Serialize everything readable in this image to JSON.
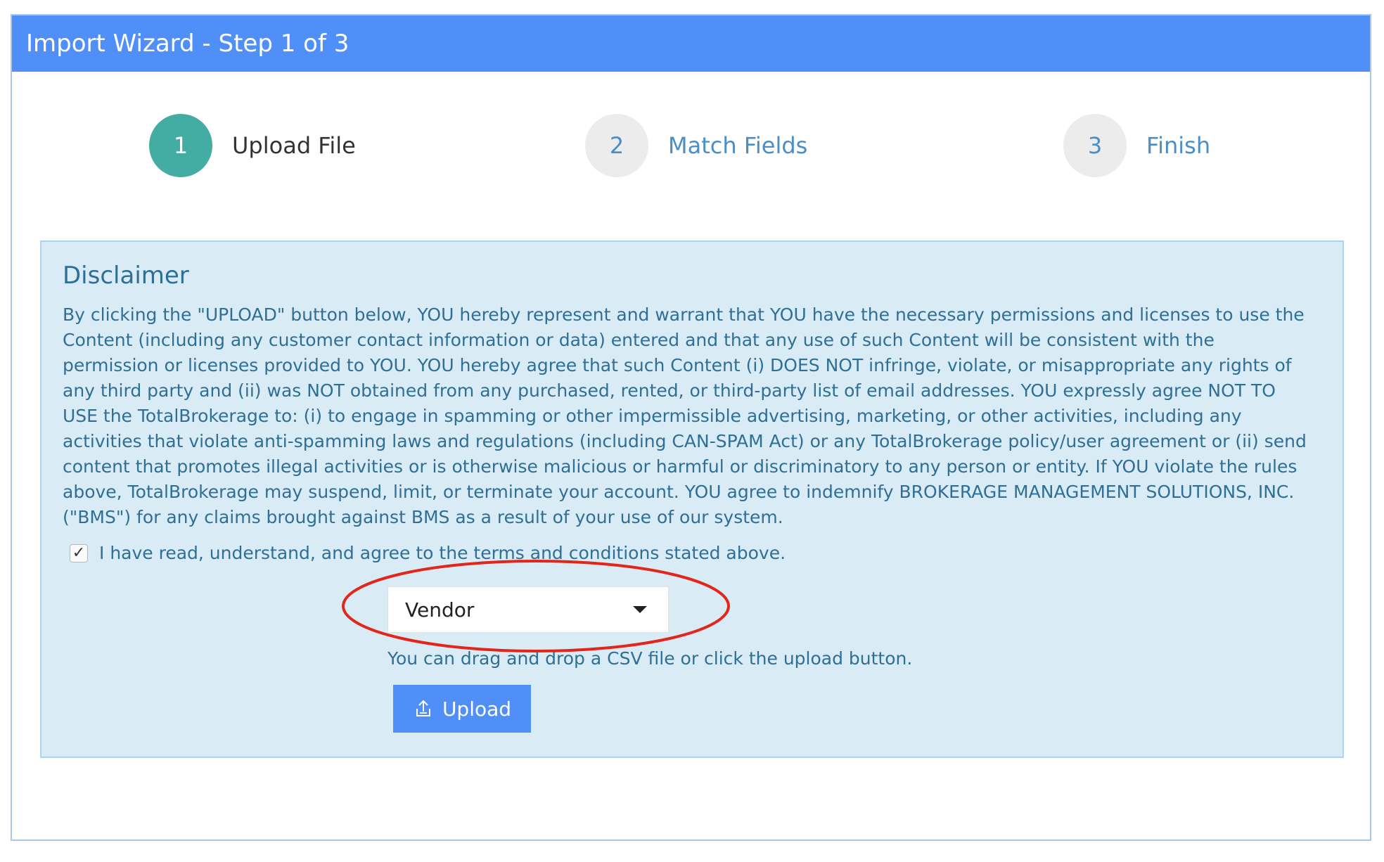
{
  "window": {
    "title": "Import Wizard - Step 1 of 3"
  },
  "steps": [
    {
      "number": "1",
      "label": "Upload File",
      "active": true
    },
    {
      "number": "2",
      "label": "Match Fields",
      "active": false
    },
    {
      "number": "3",
      "label": "Finish",
      "active": false
    }
  ],
  "disclaimer": {
    "title": "Disclaimer",
    "body": "By clicking the \"UPLOAD\" button below, YOU hereby represent and warrant that YOU have the necessary permissions and licenses to use the Content (including any customer contact information or data) entered and that any use of such Content will be consistent with the permission or licenses provided to YOU. YOU hereby agree that such Content (i) DOES NOT infringe, violate, or misappropriate any rights of any third party and (ii) was NOT obtained from any purchased, rented, or third-party list of email addresses. YOU expressly agree NOT TO USE the TotalBrokerage to: (i) to engage in spamming or other impermissible advertising, marketing, or other activities, including any activities that violate anti-spamming laws and regulations (including CAN-SPAM Act) or any TotalBrokerage policy/user agreement or (ii) send content that promotes illegal activities or is otherwise malicious or harmful or discriminatory to any person or entity. If YOU violate the rules above, TotalBrokerage may suspend, limit, or terminate your account. YOU agree to indemnify BROKERAGE MANAGEMENT SOLUTIONS, INC. (\"BMS\") for any claims brought against BMS as a result of your use of our system.",
    "agree_label": "I have read, understand, and agree to the terms and conditions stated above.",
    "agree_checked": true,
    "checkmark": "✓"
  },
  "type_select": {
    "value": "Vendor"
  },
  "upload": {
    "help_text": "You can drag and drop a CSV file or click the upload button.",
    "button_label": "Upload",
    "icon": "upload-icon"
  },
  "colors": {
    "header": "#4f8ff7",
    "active_step": "#43ada3",
    "inactive_step": "#ececec",
    "disclaimer_bg": "#d9ecf6",
    "annotation": "#e3261b"
  }
}
